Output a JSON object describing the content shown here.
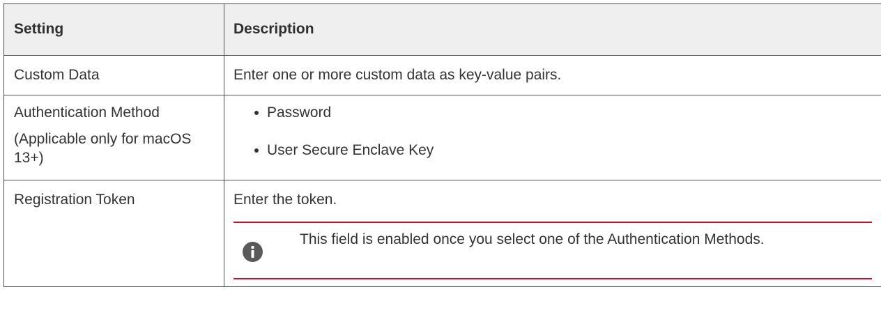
{
  "table": {
    "headers": {
      "setting": "Setting",
      "description": "Description"
    },
    "rows": [
      {
        "setting": "Custom Data",
        "description": "Enter one or more custom data as key-value pairs."
      },
      {
        "setting": "Authentication Method",
        "setting_note": "(Applicable only for macOS 13+)",
        "options": [
          "Password",
          "User Secure Enclave Key"
        ]
      },
      {
        "setting": "Registration Token",
        "description": "Enter the token.",
        "note": {
          "icon": "info-icon",
          "text": "This field is enabled once you select one of the Authentication Methods.",
          "border_color": "#c8102e"
        }
      }
    ]
  }
}
